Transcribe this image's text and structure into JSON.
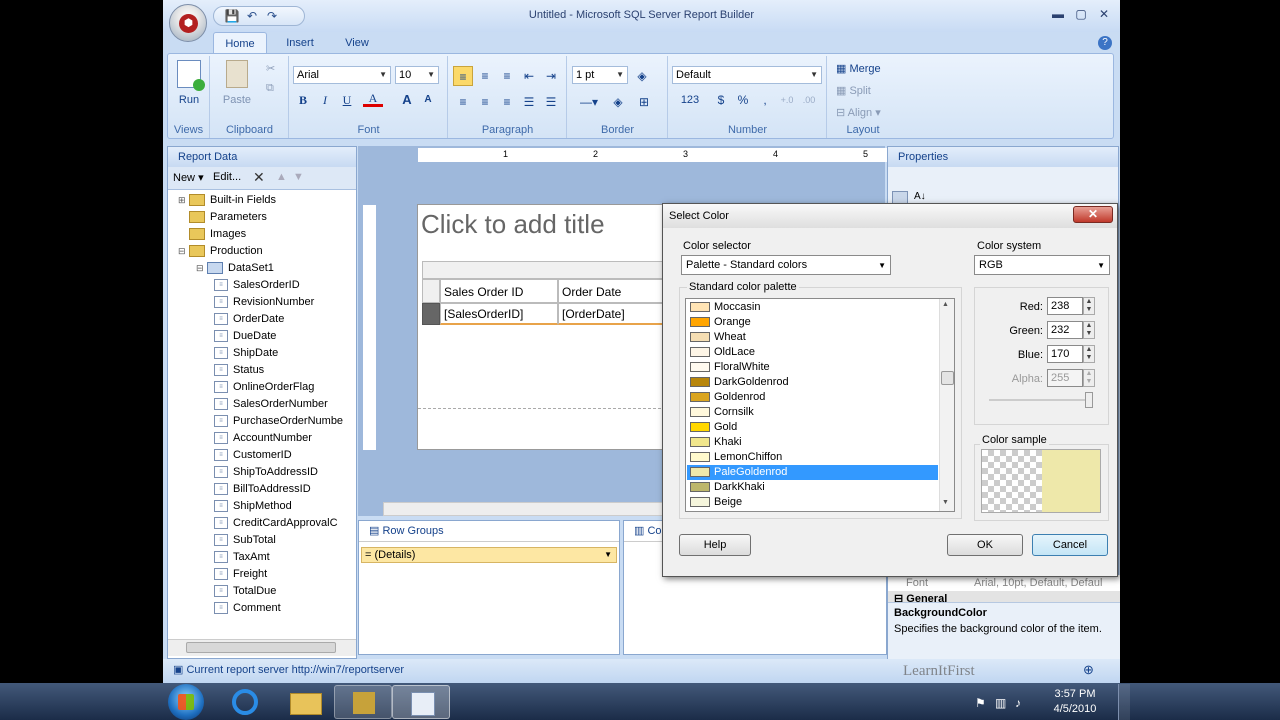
{
  "window": {
    "title": "Untitled - Microsoft SQL Server Report Builder",
    "min": "▬",
    "max": "▢",
    "close": "✕"
  },
  "qat": {
    "save": "💾",
    "undo": "↶",
    "redo": "↷"
  },
  "tabs": [
    "Home",
    "Insert",
    "View"
  ],
  "ribbon": {
    "groups": {
      "views": "Views",
      "clipboard": "Clipboard",
      "font": "Font",
      "paragraph": "Paragraph",
      "border": "Border",
      "number": "Number",
      "layout": "Layout"
    },
    "run": "Run",
    "paste": "Paste",
    "font_name": "Arial",
    "font_size": "10",
    "bold": "B",
    "italic": "I",
    "underline": "U",
    "fontcolor": "A",
    "grow": "A",
    "shrink": "A",
    "border_width": "1 pt",
    "number_format": "Default",
    "number_123": "123",
    "currency": "$",
    "percent": "%",
    "comma": ",",
    "merge": "Merge",
    "split": "Split",
    "align": "Align"
  },
  "report_data": {
    "title": "Report Data",
    "new": "New",
    "edit": "Edit...",
    "items": [
      {
        "label": "Built-in Fields",
        "type": "folder",
        "indent": 0
      },
      {
        "label": "Parameters",
        "type": "folder",
        "indent": 0
      },
      {
        "label": "Images",
        "type": "folder",
        "indent": 0
      },
      {
        "label": "Production",
        "type": "folder",
        "indent": 0
      },
      {
        "label": "DataSet1",
        "type": "dataset",
        "indent": 1
      },
      {
        "label": "SalesOrderID",
        "type": "field",
        "indent": 2
      },
      {
        "label": "RevisionNumber",
        "type": "field",
        "indent": 2
      },
      {
        "label": "OrderDate",
        "type": "field",
        "indent": 2
      },
      {
        "label": "DueDate",
        "type": "field",
        "indent": 2
      },
      {
        "label": "ShipDate",
        "type": "field",
        "indent": 2
      },
      {
        "label": "Status",
        "type": "field",
        "indent": 2
      },
      {
        "label": "OnlineOrderFlag",
        "type": "field",
        "indent": 2
      },
      {
        "label": "SalesOrderNumber",
        "type": "field",
        "indent": 2
      },
      {
        "label": "PurchaseOrderNumbe",
        "type": "field",
        "indent": 2
      },
      {
        "label": "AccountNumber",
        "type": "field",
        "indent": 2
      },
      {
        "label": "CustomerID",
        "type": "field",
        "indent": 2
      },
      {
        "label": "ShipToAddressID",
        "type": "field",
        "indent": 2
      },
      {
        "label": "BillToAddressID",
        "type": "field",
        "indent": 2
      },
      {
        "label": "ShipMethod",
        "type": "field",
        "indent": 2
      },
      {
        "label": "CreditCardApprovalC",
        "type": "field",
        "indent": 2
      },
      {
        "label": "SubTotal",
        "type": "field",
        "indent": 2
      },
      {
        "label": "TaxAmt",
        "type": "field",
        "indent": 2
      },
      {
        "label": "Freight",
        "type": "field",
        "indent": 2
      },
      {
        "label": "TotalDue",
        "type": "field",
        "indent": 2
      },
      {
        "label": "Comment",
        "type": "field",
        "indent": 2
      }
    ]
  },
  "design": {
    "ruler": [
      "1",
      "2",
      "3",
      "4",
      "5"
    ],
    "title_placeholder": "Click to add title",
    "header_cells": [
      "Sales Order ID",
      "Order Date"
    ],
    "data_cells": [
      "[SalesOrderID]",
      "[OrderDate]"
    ]
  },
  "row_groups": {
    "title": "Row Groups",
    "item": "= (Details)"
  },
  "column_groups": {
    "title": "Co"
  },
  "properties": {
    "title": "Properties",
    "font_row": {
      "name": "Font",
      "value": "Arial, 10pt, Default, Defaul"
    },
    "section": "General",
    "desc_title": "BackgroundColor",
    "desc_text": "Specifies the background color of the item."
  },
  "status": {
    "server": "Current report server http://win7/reportserver"
  },
  "watermark": "LearnItFirst",
  "dialog": {
    "title": "Select Color",
    "color_selector_label": "Color selector",
    "color_selector_value": "Palette - Standard colors",
    "color_system_label": "Color system",
    "color_system_value": "RGB",
    "palette_label": "Standard color palette",
    "colors": [
      {
        "name": "Moccasin",
        "hex": "#ffe4b5"
      },
      {
        "name": "Orange",
        "hex": "#ffa500"
      },
      {
        "name": "Wheat",
        "hex": "#f5deb3"
      },
      {
        "name": "OldLace",
        "hex": "#fdf5e6"
      },
      {
        "name": "FloralWhite",
        "hex": "#fffaf0"
      },
      {
        "name": "DarkGoldenrod",
        "hex": "#b8860b"
      },
      {
        "name": "Goldenrod",
        "hex": "#daa520"
      },
      {
        "name": "Cornsilk",
        "hex": "#fff8dc"
      },
      {
        "name": "Gold",
        "hex": "#ffd700"
      },
      {
        "name": "Khaki",
        "hex": "#f0e68c"
      },
      {
        "name": "LemonChiffon",
        "hex": "#fffacd"
      },
      {
        "name": "PaleGoldenrod",
        "hex": "#eee8aa"
      },
      {
        "name": "DarkKhaki",
        "hex": "#bdb76b"
      },
      {
        "name": "Beige",
        "hex": "#f5f5dc"
      }
    ],
    "selected_color": "PaleGoldenrod",
    "red_label": "Red:",
    "red": "238",
    "green_label": "Green:",
    "green": "232",
    "blue_label": "Blue:",
    "blue": "170",
    "alpha_label": "Alpha:",
    "alpha": "255",
    "sample_label": "Color sample",
    "sample_hex": "#eee8aa",
    "help": "Help",
    "ok": "OK",
    "cancel": "Cancel"
  },
  "clock": {
    "time": "3:57 PM",
    "date": "4/5/2010"
  }
}
